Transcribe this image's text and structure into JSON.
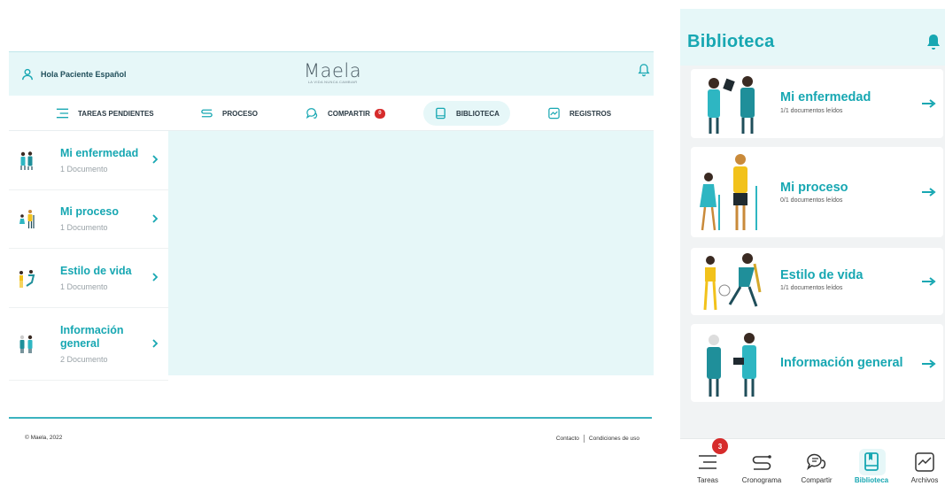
{
  "desktop": {
    "greeting": "Hola Paciente Español",
    "logo": {
      "name": "Maela",
      "tagline": "LA VIDA NUNCA CAMBIAR"
    },
    "nav": [
      {
        "label": "TAREAS PENDIENTES",
        "icon": "list-icon"
      },
      {
        "label": "PROCESO",
        "icon": "timeline-icon"
      },
      {
        "label": "COMPARTIR",
        "icon": "chat-icon",
        "badge": "0"
      },
      {
        "label": "BIBLIOTECA",
        "icon": "book-icon",
        "active": true
      },
      {
        "label": "REGISTROS",
        "icon": "chart-icon"
      }
    ],
    "library": [
      {
        "title": "Mi enfermedad",
        "subtitle": "1 Documento"
      },
      {
        "title": "Mi proceso",
        "subtitle": "1 Documento"
      },
      {
        "title": "Estilo de vida",
        "subtitle": "1 Documento"
      },
      {
        "title": "Información general",
        "subtitle": "2 Documento"
      }
    ],
    "footer": {
      "copyright": "© Maela, 2022",
      "contact": "Contacto",
      "terms": "Condiciones de uso"
    }
  },
  "mobile": {
    "title": "Biblioteca",
    "cards": [
      {
        "title": "Mi enfermedad",
        "subtitle": "1/1 documentos leídos"
      },
      {
        "title": "Mi proceso",
        "subtitle": "0/1 documentos leídos"
      },
      {
        "title": "Estilo de vida",
        "subtitle": "1/1 documentos leídos"
      },
      {
        "title": "Información general",
        "subtitle": ""
      }
    ],
    "tabs": [
      {
        "label": "Tareas",
        "icon": "list-icon",
        "badge": "3"
      },
      {
        "label": "Cronograma",
        "icon": "timeline-icon"
      },
      {
        "label": "Compartir",
        "icon": "chat-icon"
      },
      {
        "label": "Biblioteca",
        "icon": "book-icon",
        "active": true
      },
      {
        "label": "Archivos",
        "icon": "chart-icon"
      }
    ]
  },
  "colors": {
    "accent": "#17a7b2",
    "light": "#e6f7f8",
    "badge": "#d62b2b"
  }
}
